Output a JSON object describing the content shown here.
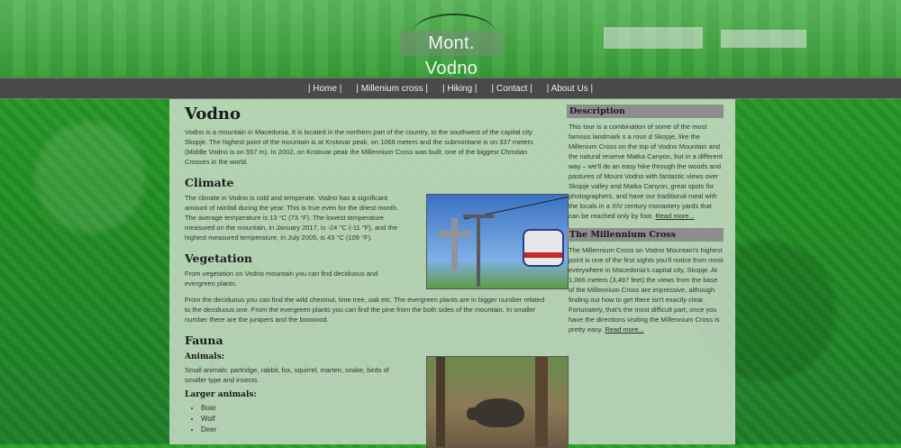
{
  "site": {
    "logo_text": "Mont. Vodno"
  },
  "nav": {
    "items": [
      "| Home |",
      "| Millenium cross |",
      "| Hiking |",
      "| Contact |",
      "| About Us |"
    ]
  },
  "main": {
    "title": "Vodno",
    "intro": "Vodno is a mountain in Macedonia. It is located in the northern part of the country, to the southwest of the capital city Skopje. The highest point of the mountain is at Krstovar peak, on 1066 meters and the submontane is on 337 meters (Middle Vodno is on 557 m). In 2002, on Krstovar peak the Millennium Cross was built, one of the biggest Christian Crosses in the world.",
    "climate": {
      "heading": "Climate",
      "text": "The climate in Vodno is cold and temperate. Vodno has a significant amount of rainfall during the year. This is true even for the driest month. The average temperature is 13 °C (73 °F). The lowest temperature measured on the mountain, in January 2017, is -24 °C (-11 °F), and the highest measured temperature, in July 2005, is 43 °C (109 °F)."
    },
    "vegetation": {
      "heading": "Vegetation",
      "text1": "From vegetation on Vodno mountain you can find deciduous and evergreen plants.",
      "text2": "From the deciduous you can find the wild chestnut, lime tree, oak etc. The evergreen plants are in bigger number related to the deciduous one. From the evergreen plants you can find the pine from the both sides of the mountain. In smaller number there are the junipers and the boxwood."
    },
    "fauna": {
      "heading": "Fauna",
      "small_heading": "Animals:",
      "small_text": "Small animals: partridge, rabbit, fox, squirrel, marten, snake, birds of smaller type and insects.",
      "larger_heading": "Larger animals:",
      "larger_list": [
        "Boar",
        "Wolf",
        "Deer"
      ]
    }
  },
  "sidebar": {
    "description": {
      "heading": "Description",
      "text": "This tour is a combination of some of the most famous landmark s a roun d Skopje, like the Millenium Cross on the top of Vodno Mountain and the natural reserve Matka Canyon, but in a different way – we'll do an easy hike through the woods and pastures of Mount Vodno with fantastic views over Skopje valley and Matka Canyon, great spots for photographers, and have our traditional meal with the locals in a XIV century monastery yards that can be reached only by foot.",
      "more": "Read more..."
    },
    "millennium": {
      "heading": "The Millennium Cross",
      "text": "The Millennium Cross on Vodno Mountain's highest point is one of the first sights you'll notice from most everywhere in Macedonia's capital city, Skopje. At 1,066 meters (3,497 feet) the views from the base of the Millennium Cross are impressive, although finding out how to get there isn't exactly clear. Fortunately, that's the most difficult part; once you have the directions visiting the Millennium Cross is pretty easy.",
      "more": "Read more..."
    }
  },
  "icons": [
    "logo-arc-icon"
  ]
}
